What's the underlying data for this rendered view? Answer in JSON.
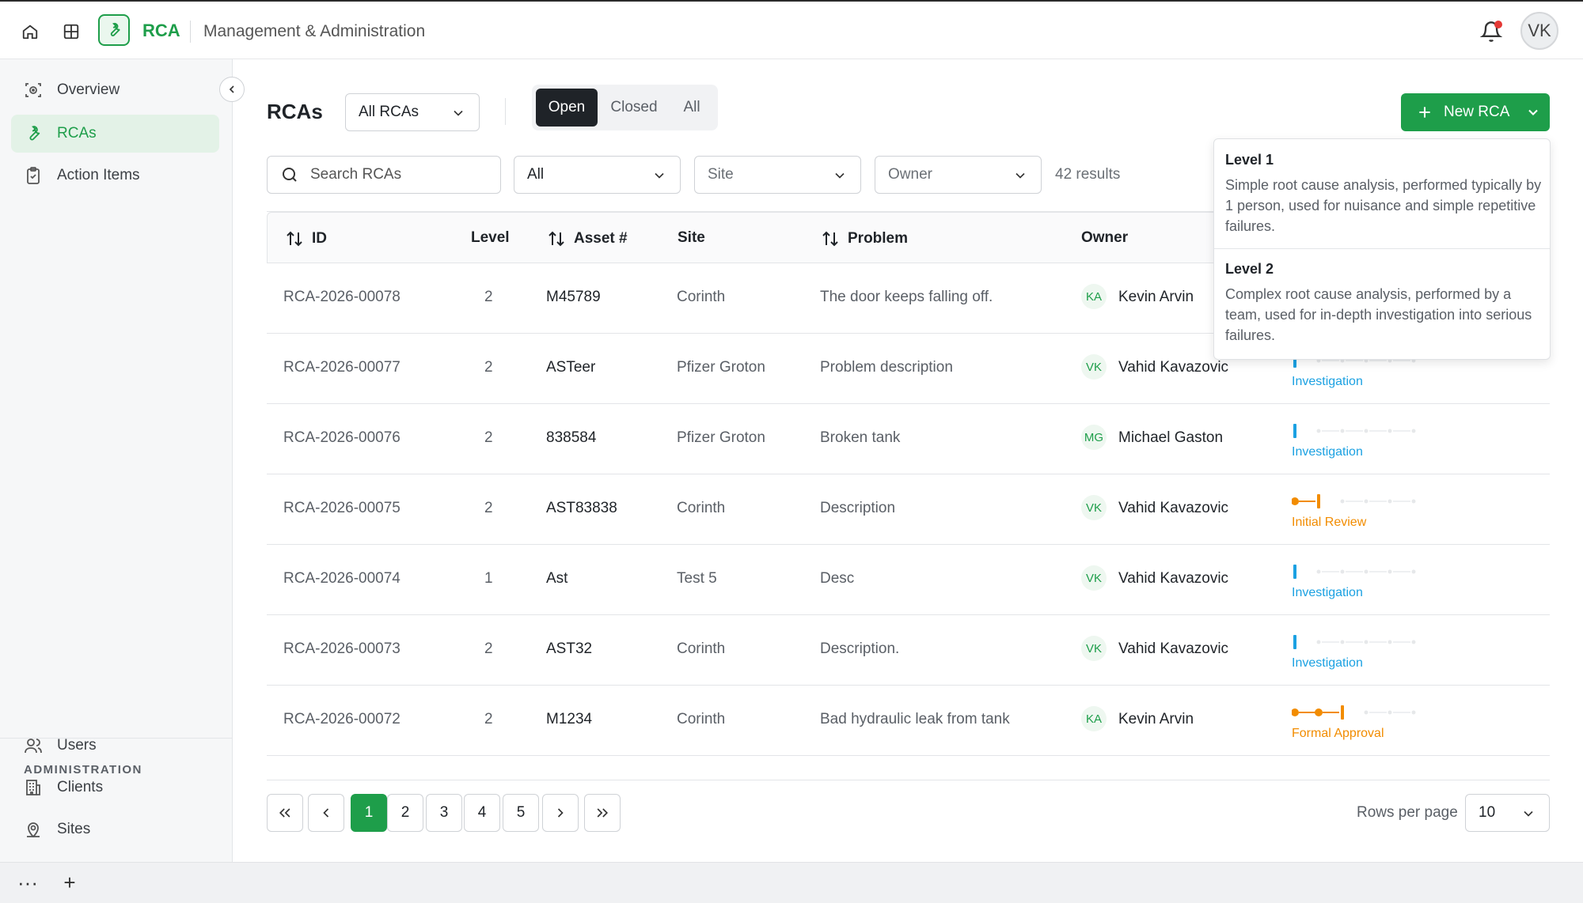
{
  "topbar": {
    "app_name": "RCA",
    "section_title": "Management & Administration",
    "user_initials": "VK"
  },
  "sidebar": {
    "items": [
      {
        "label": "Overview",
        "icon": "overview-icon"
      },
      {
        "label": "RCAs",
        "icon": "wrench-icon",
        "active": true
      },
      {
        "label": "Action Items",
        "icon": "clipboard-icon"
      }
    ],
    "admin_heading": "ADMINISTRATION",
    "admin_items": [
      {
        "label": "Users",
        "icon": "users-icon"
      },
      {
        "label": "Clients",
        "icon": "building-icon"
      },
      {
        "label": "Sites",
        "icon": "location-icon"
      }
    ]
  },
  "bottombar": {
    "more": "···",
    "add": "+"
  },
  "header": {
    "title": "RCAs",
    "scope_select": "All RCAs",
    "tabs": [
      "Open",
      "Closed",
      "All"
    ],
    "active_tab": "Open",
    "new_button": "New RCA"
  },
  "filters": {
    "search_placeholder": "Search RCAs",
    "level_select": "All",
    "site_placeholder": "Site",
    "owner_placeholder": "Owner",
    "results": "42 results"
  },
  "table": {
    "headers": {
      "id": "ID",
      "level": "Level",
      "asset": "Asset #",
      "site": "Site",
      "problem": "Problem",
      "owner": "Owner"
    },
    "rows": [
      {
        "id": "RCA-2026-00078",
        "level": "2",
        "asset": "M45789",
        "site": "Corinth",
        "problem": "The door keeps falling off.",
        "initials": "KA",
        "owner": "Kevin Arvin",
        "status": "",
        "status_step": 0,
        "status_color": "#1ba1e2"
      },
      {
        "id": "RCA-2026-00077",
        "level": "2",
        "asset": "ASTeer",
        "site": "Pfizer Groton",
        "problem": "Problem description",
        "initials": "VK",
        "owner": "Vahid Kavazovic",
        "status": "Investigation",
        "status_step": 0,
        "status_color": "#1ba1e2"
      },
      {
        "id": "RCA-2026-00076",
        "level": "2",
        "asset": "838584",
        "site": "Pfizer Groton",
        "problem": "Broken tank",
        "initials": "MG",
        "owner": "Michael Gaston",
        "status": "Investigation",
        "status_step": 0,
        "status_color": "#1ba1e2"
      },
      {
        "id": "RCA-2026-00075",
        "level": "2",
        "asset": "AST83838",
        "site": "Corinth",
        "problem": "Description",
        "initials": "VK",
        "owner": "Vahid Kavazovic",
        "status": "Initial Review",
        "status_step": 1,
        "status_color": "#f28c00"
      },
      {
        "id": "RCA-2026-00074",
        "level": "1",
        "asset": "Ast",
        "site": "Test 5",
        "problem": "Desc",
        "initials": "VK",
        "owner": "Vahid Kavazovic",
        "status": "Investigation",
        "status_step": 0,
        "status_color": "#1ba1e2"
      },
      {
        "id": "RCA-2026-00073",
        "level": "2",
        "asset": "AST32",
        "site": "Corinth",
        "problem": "Description.",
        "initials": "VK",
        "owner": "Vahid Kavazovic",
        "status": "Investigation",
        "status_step": 0,
        "status_color": "#1ba1e2"
      },
      {
        "id": "RCA-2026-00072",
        "level": "2",
        "asset": "M1234",
        "site": "Corinth",
        "problem": "Bad hydraulic leak from tank",
        "initials": "KA",
        "owner": "Kevin Arvin",
        "status": "Formal Approval",
        "status_step": 2,
        "status_color": "#f28c00"
      }
    ]
  },
  "pagination": {
    "pages": [
      "1",
      "2",
      "3",
      "4",
      "5"
    ],
    "current": "1",
    "rows_per_page_label": "Rows per page",
    "rows_per_page": "10"
  },
  "popover": {
    "level1_title": "Level 1",
    "level1_desc": "Simple root cause analysis, performed typically by 1 person, used for nuisance and simple repetitive failures.",
    "level2_title": "Level 2",
    "level2_desc": "Complex root cause analysis, performed by a team, used for in-depth investigation into serious failures."
  },
  "colors": {
    "accent": "#1e9e4a",
    "investigation": "#1ba1e2",
    "review": "#f28c00"
  }
}
